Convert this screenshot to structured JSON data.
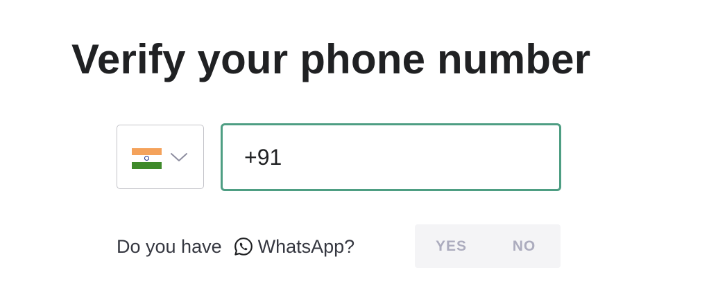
{
  "page": {
    "title": "Verify your phone number"
  },
  "country_select": {
    "selected_country_flag": "india-flag-icon",
    "chevron_icon": "chevron-down-icon"
  },
  "phone_input": {
    "value": "+91"
  },
  "whatsapp_prompt": {
    "text_before_icon": "Do you have",
    "icon": "whatsapp-icon",
    "text_after_icon": "WhatsApp?"
  },
  "whatsapp_toggle": {
    "yes_label": "YES",
    "no_label": "NO"
  },
  "colors": {
    "focus_border": "#4e9e83",
    "toggle_background": "#f4f4f6",
    "toggle_text": "#acacbe"
  }
}
